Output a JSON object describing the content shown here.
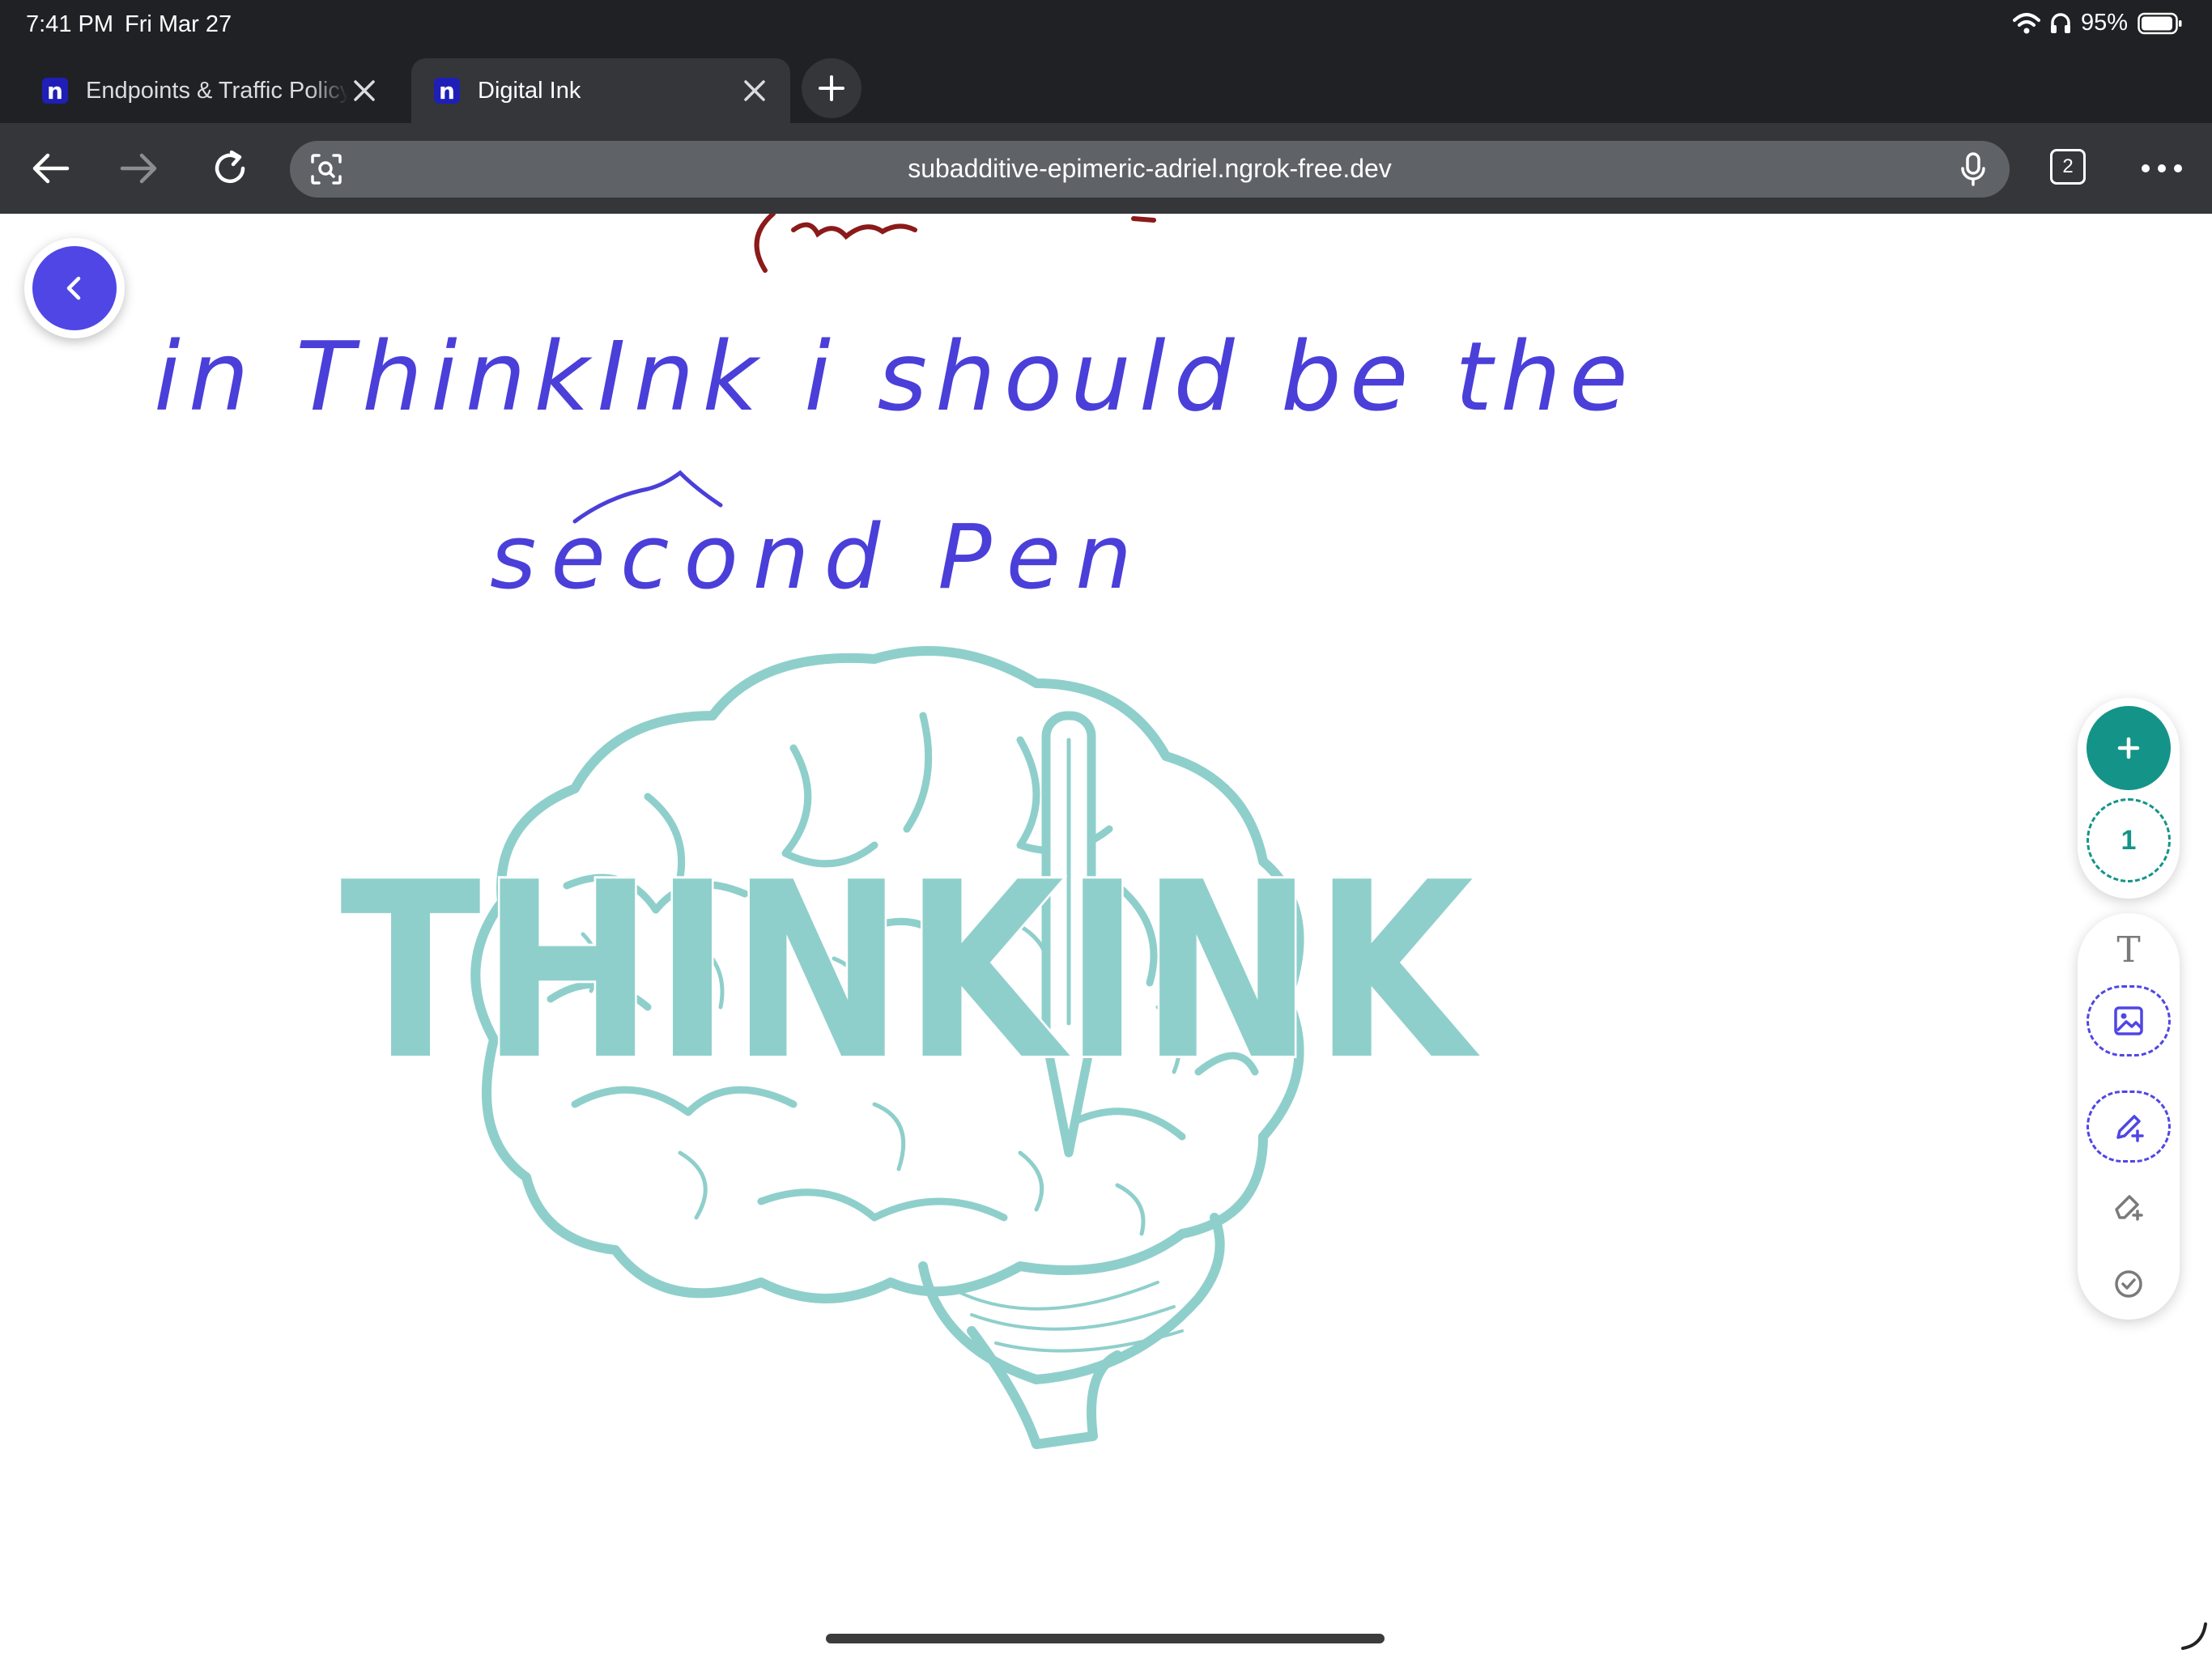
{
  "status_bar": {
    "time": "7:41 PM",
    "date": "Fri Mar 27",
    "battery": "95%"
  },
  "tabs": [
    {
      "title": "Endpoints & Traffic Policy",
      "favicon": "n",
      "active": false
    },
    {
      "title": "Digital Ink",
      "favicon": "n",
      "active": true
    }
  ],
  "toolbar": {
    "url": "subadditive-epimeric-adriel.ngrok-free.dev",
    "tab_count": "2"
  },
  "canvas": {
    "handwriting": {
      "line1": "in ThinkInk i should be the",
      "line2": "second Pen"
    },
    "logo_text": "THINKINK"
  },
  "right_panel": {
    "page_number": "1",
    "add_page_icon": "plus-icon",
    "tools": [
      "text-tool-icon",
      "image-tool-icon",
      "pen-tool-icon",
      "eraser-tool-icon",
      "check-icon"
    ]
  },
  "colors": {
    "accent_indigo": "#4f46e5",
    "accent_teal": "#149488",
    "ink_blue": "#4a3fd9",
    "ink_red": "#8b1a1a",
    "logo_teal": "#8fcfcb"
  }
}
